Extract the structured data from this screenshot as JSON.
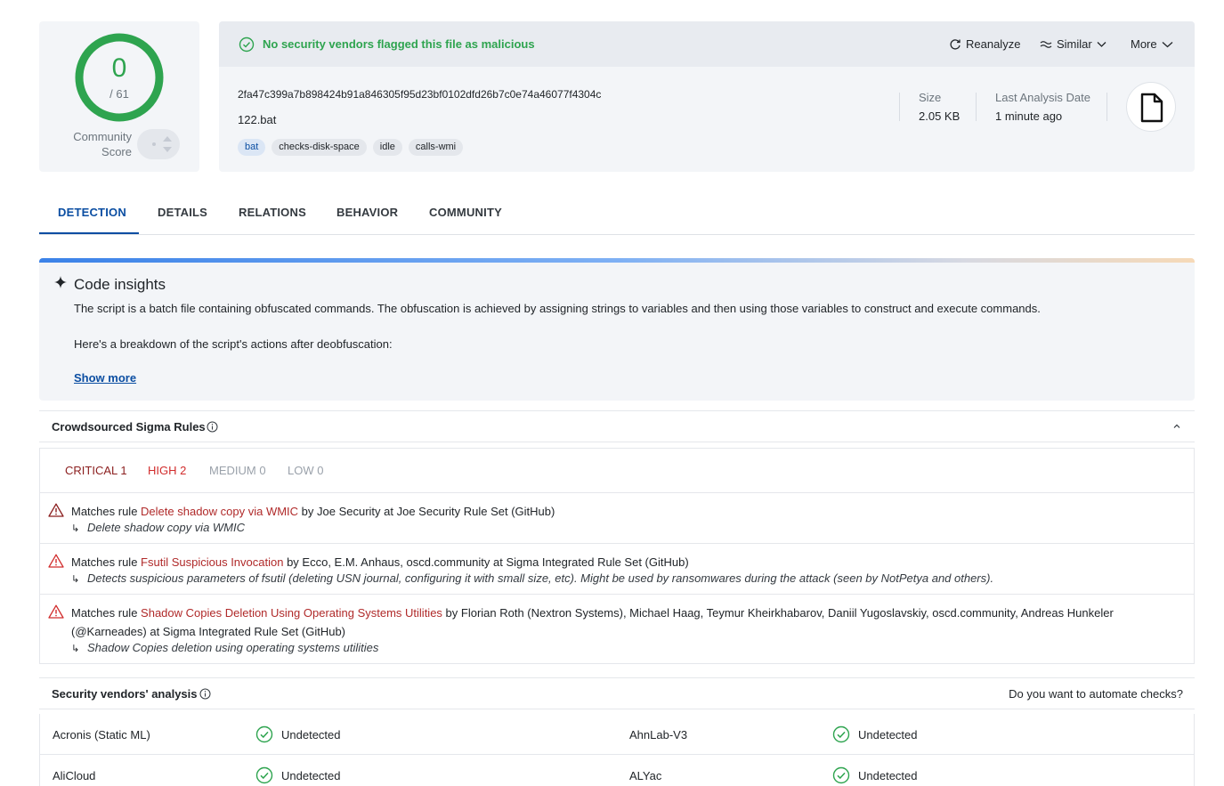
{
  "score": {
    "detections": "0",
    "total": "/ 61",
    "community_label": "Community Score"
  },
  "file": {
    "banner": "No security vendors flagged this file as malicious",
    "actions": {
      "reanalyze": "Reanalyze",
      "similar": "Similar",
      "more": "More"
    },
    "hash": "2fa47c399a7b898424b91a846305f95d23bf0102dfd26b7c0e74a46077f4304c",
    "name": "122.bat",
    "tags": [
      "bat",
      "checks-disk-space",
      "idle",
      "calls-wmi"
    ],
    "size_label": "Size",
    "size_value": "2.05 KB",
    "date_label": "Last Analysis Date",
    "date_value": "1 minute ago"
  },
  "tabs": [
    "DETECTION",
    "DETAILS",
    "RELATIONS",
    "BEHAVIOR",
    "COMMUNITY"
  ],
  "insights": {
    "title": "Code insights",
    "p1": "The script is a batch file containing obfuscated commands. The obfuscation is achieved by assigning strings to variables and then using those variables to construct and execute commands.",
    "p2": "Here's a breakdown of the script's actions after deobfuscation:",
    "show_more": "Show more"
  },
  "sigma": {
    "title": "Crowdsourced Sigma Rules",
    "severities": {
      "critical": "CRITICAL 1",
      "high": "HIGH 2",
      "medium": "MEDIUM 0",
      "low": "LOW 0"
    },
    "rules": [
      {
        "prefix": "Matches rule ",
        "name": "Delete shadow copy via WMIC",
        "suffix": " by Joe Security at Joe Security Rule Set (GitHub)",
        "desc": "Delete shadow copy via WMIC"
      },
      {
        "prefix": "Matches rule ",
        "name": "Fsutil Suspicious Invocation",
        "suffix": " by Ecco, E.M. Anhaus, oscd.community at Sigma Integrated Rule Set (GitHub)",
        "desc": "Detects suspicious parameters of fsutil (deleting USN journal, configuring it with small size, etc). Might be used by ransomwares during the attack (seen by NotPetya and others)."
      },
      {
        "prefix": "Matches rule ",
        "name": "Shadow Copies Deletion Using Operating Systems Utilities",
        "suffix": " by Florian Roth (Nextron Systems), Michael Haag, Teymur Kheirkhabarov, Daniil Yugoslavskiy, oscd.community, Andreas Hunkeler (@Karneades) at Sigma Integrated Rule Set (GitHub)",
        "desc": "Shadow Copies deletion using operating systems utilities"
      }
    ]
  },
  "vendors": {
    "title": "Security vendors' analysis",
    "automate": "Do you want to automate checks?",
    "rows": [
      {
        "left_name": "Acronis (Static ML)",
        "left_status": "Undetected",
        "right_name": "AhnLab-V3",
        "right_status": "Undetected"
      },
      {
        "left_name": "AliCloud",
        "left_status": "Undetected",
        "right_name": "ALYac",
        "right_status": "Undetected"
      }
    ]
  },
  "colors": {
    "accent": "#0b4ea2",
    "clean": "#2ea44f",
    "critical": "#8b1e1e",
    "high": "#d12c2c",
    "rule_link": "#b02a2a"
  }
}
